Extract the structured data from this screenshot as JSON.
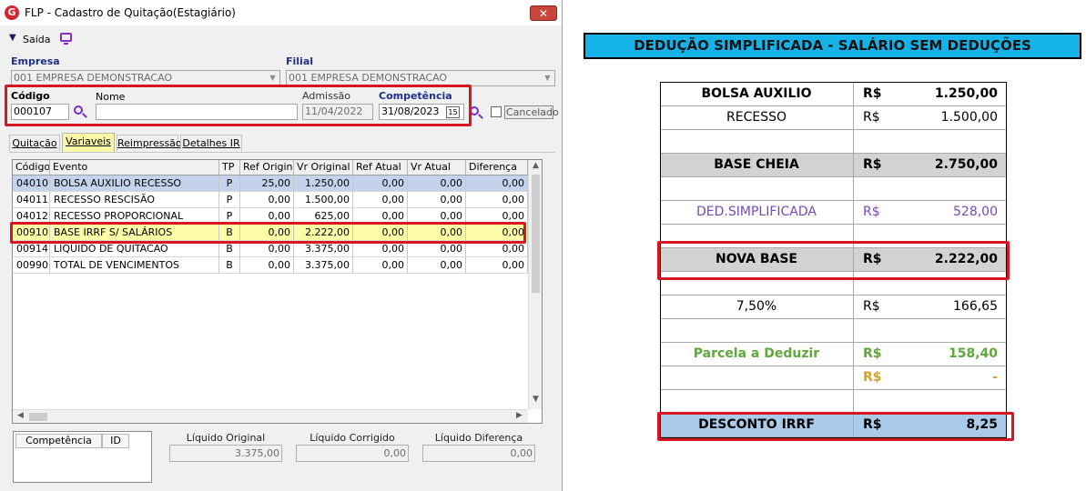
{
  "window": {
    "title": "FLP - Cadastro de Quitação(Estagiário)",
    "close_glyph": "✕",
    "logo_letter": "G"
  },
  "toolbar": {
    "exit_label": "Saída"
  },
  "form": {
    "empresa_label": "Empresa",
    "empresa_value": "001 EMPRESA DEMONSTRACAO",
    "filial_label": "Filial",
    "filial_value": "001 EMPRESA DEMONSTRACAO",
    "codigo_label": "Código",
    "codigo_value": "000107",
    "nome_label": "Nome",
    "nome_value": "",
    "admissao_label": "Admissão",
    "admissao_value": "11/04/2022",
    "competencia_label": "Competência",
    "competencia_value": "31/08/2023",
    "cancelado_label": "Cancelado",
    "calendar_glyph": "15"
  },
  "tabs": [
    {
      "label": "Quitação",
      "active": false
    },
    {
      "label": "Variaveis",
      "active": true
    },
    {
      "label": "Reimpressão",
      "active": false
    },
    {
      "label": "Detalhes IR",
      "active": false
    }
  ],
  "grid": {
    "columns": [
      "Código",
      "Evento",
      "TP",
      "Ref Original",
      "Vr Original",
      "Ref Atual",
      "Vr Atual",
      "Diferença"
    ],
    "rows": [
      {
        "codigo": "04010",
        "evento": "BOLSA AUXILIO RECESSO",
        "tp": "P",
        "ref_original": "25,00",
        "vr_original": "1.250,00",
        "ref_atual": "0,00",
        "vr_atual": "0,00",
        "diferenca": "0,00",
        "state": "selected"
      },
      {
        "codigo": "04011",
        "evento": "RECESSO RESCISÃO",
        "tp": "P",
        "ref_original": "0,00",
        "vr_original": "1.500,00",
        "ref_atual": "0,00",
        "vr_atual": "0,00",
        "diferenca": "0,00",
        "state": ""
      },
      {
        "codigo": "04012",
        "evento": "RECESSO PROPORCIONAL",
        "tp": "P",
        "ref_original": "0,00",
        "vr_original": "625,00",
        "ref_atual": "0,00",
        "vr_atual": "0,00",
        "diferenca": "0,00",
        "state": ""
      },
      {
        "codigo": "00910",
        "evento": "BASE IRRF S/ SALÁRIOS",
        "tp": "B",
        "ref_original": "0,00",
        "vr_original": "2.222,00",
        "ref_atual": "0,00",
        "vr_atual": "0,00",
        "diferenca": "0,00",
        "state": "highlighted"
      },
      {
        "codigo": "00914",
        "evento": "LIQUIDO DE QUITACAO",
        "tp": "B",
        "ref_original": "0,00",
        "vr_original": "3.375,00",
        "ref_atual": "0,00",
        "vr_atual": "0,00",
        "diferenca": "0,00",
        "state": ""
      },
      {
        "codigo": "00990",
        "evento": "TOTAL DE VENCIMENTOS",
        "tp": "B",
        "ref_original": "0,00",
        "vr_original": "3.375,00",
        "ref_atual": "0,00",
        "vr_atual": "0,00",
        "diferenca": "0,00",
        "state": ""
      }
    ]
  },
  "bottom": {
    "mini_cols": [
      "Competência",
      "ID"
    ],
    "liquido_original_label": "Líquido Original",
    "liquido_original_value": "3.375,00",
    "liquido_corrigido_label": "Líquido Corrigido",
    "liquido_corrigido_value": "0,00",
    "liquido_diferenca_label": "Líquido Diferença",
    "liquido_diferenca_value": "0,00"
  },
  "sheet": {
    "banner": "DEDUÇÃO SIMPLIFICADA - SALÁRIO SEM DEDUÇÕES",
    "rows": [
      {
        "label": "BOLSA AUXILIO",
        "cur": "R$",
        "value": "1.250,00",
        "style": "bold",
        "color": "#000000"
      },
      {
        "label": "RECESSO",
        "cur": "R$",
        "value": "1.500,00",
        "style": "",
        "color": "#000000"
      },
      {
        "label": "",
        "cur": "",
        "value": "",
        "style": "",
        "color": "#000000"
      },
      {
        "label": "BASE CHEIA",
        "cur": "R$",
        "value": "2.750,00",
        "style": "bold gray",
        "color": "#000000"
      },
      {
        "label": "",
        "cur": "",
        "value": "",
        "style": "",
        "color": "#000000"
      },
      {
        "label": "DED.SIMPLIFICADA",
        "cur": "R$",
        "value": "528,00",
        "style": "",
        "color": "#7a48b0"
      },
      {
        "label": "",
        "cur": "",
        "value": "",
        "style": "",
        "color": "#000000"
      },
      {
        "label": "NOVA BASE",
        "cur": "R$",
        "value": "2.222,00",
        "style": "bold gray",
        "color": "#000000"
      },
      {
        "label": "",
        "cur": "",
        "value": "",
        "style": "",
        "color": "#000000"
      },
      {
        "label": "7,50%",
        "cur": "R$",
        "value": "166,65",
        "style": "",
        "color": "#000000"
      },
      {
        "label": "",
        "cur": "",
        "value": "",
        "style": "",
        "color": "#000000"
      },
      {
        "label": "Parcela a Deduzir",
        "cur": "R$",
        "value": "158,40",
        "style": "bold",
        "color": "#5fa83a"
      },
      {
        "label": "",
        "cur": "R$",
        "value": "-",
        "style": "bold",
        "color": "#d6a228"
      },
      {
        "label": "",
        "cur": "",
        "value": "",
        "style": "",
        "color": "#000000"
      },
      {
        "label": "DESCONTO IRRF",
        "cur": "R$",
        "value": "8,25",
        "style": "bold blue",
        "color": "#000000"
      }
    ]
  },
  "colors": {
    "highlight_red": "#d8161f",
    "banner_blue": "#16b3e8",
    "row_selected": "#c4d2ec",
    "row_highlight": "#fdfca6"
  }
}
